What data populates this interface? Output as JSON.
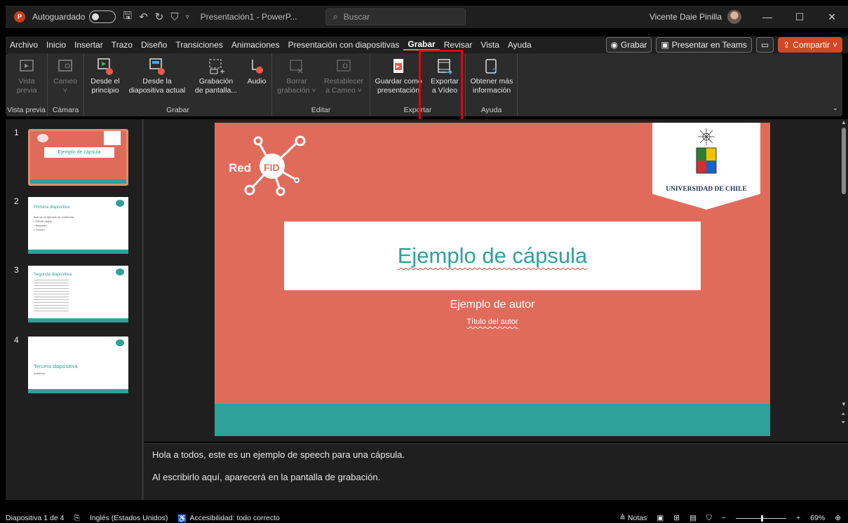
{
  "titlebar": {
    "autosave_label": "Autoguardado",
    "doc_title": "Presentación1 - PowerP...",
    "search_placeholder": "Buscar",
    "user_name": "Vicente Daie Pinilla"
  },
  "menu": {
    "items": [
      "Archivo",
      "Inicio",
      "Insertar",
      "Trazo",
      "Diseño",
      "Transiciones",
      "Animaciones",
      "Presentación con diapositivas",
      "Grabar",
      "Revisar",
      "Vista",
      "Ayuda"
    ],
    "active": "Grabar",
    "record_btn": "Grabar",
    "teams_btn": "Presentar en Teams",
    "share_btn": "Compartir"
  },
  "ribbon": {
    "groups": {
      "vista_previa": "Vista previa",
      "camara": "Cámara",
      "grabar": "Grabar",
      "editar": "Editar",
      "exportar": "Exportar",
      "ayuda": "Ayuda"
    },
    "buttons": {
      "vista_previa": [
        "Vista",
        "previa"
      ],
      "cameo": [
        "Cameo",
        "˅"
      ],
      "desde_principio": [
        "Desde el",
        "principio"
      ],
      "desde_actual": [
        "Desde la",
        "diapositiva actual"
      ],
      "grabacion_pantalla": [
        "Grabación",
        "de pantalla..."
      ],
      "audio": [
        "Audio",
        ""
      ],
      "borrar_grabacion": [
        "Borrar",
        "grabación ˅"
      ],
      "restablecer_cameo": [
        "Restablecer",
        "a Cameo ˅"
      ],
      "guardar_presentacion": [
        "Guardar como",
        "presentación"
      ],
      "exportar_video": [
        "Exportar",
        "a Vídeo"
      ],
      "obtener_info": [
        "Obtener más",
        "información"
      ]
    }
  },
  "thumbnails": [
    {
      "num": "1",
      "title": "Ejemplo de cápsula"
    },
    {
      "num": "2",
      "title": "Primera diapositiva",
      "lines": [
        "Acá va un ejemplo de contenido:",
        "• Primer objeto",
        "• Segundo",
        "• Tercero"
      ]
    },
    {
      "num": "3",
      "title": "Segunda diapositiva"
    },
    {
      "num": "4",
      "title": "Tercera diapositiva",
      "sub": "Subtítulo"
    }
  ],
  "slide": {
    "brand": "Red",
    "brand_fid": "FID",
    "university": "UNIVERSIDAD DE CHILE",
    "title": "Ejemplo de cápsula",
    "author": "Ejemplo de autor",
    "author_title": "Título del autor"
  },
  "notes": {
    "line1": "Hola a todos, este es un ejemplo de speech para una cápsula.",
    "line2": "Al escribirlo aquí, aparecerá en la pantalla de grabación."
  },
  "status": {
    "slide_counter": "Diapositiva 1 de 4",
    "language": "Inglés (Estados Unidos)",
    "accessibility": "Accesibilidad: todo correcto",
    "notes_btn": "Notas",
    "zoom": "69%"
  },
  "colors": {
    "slide_bg": "#e06b5b",
    "teal": "#2ea19b",
    "highlight": "#e3000f",
    "share": "#d24726"
  }
}
